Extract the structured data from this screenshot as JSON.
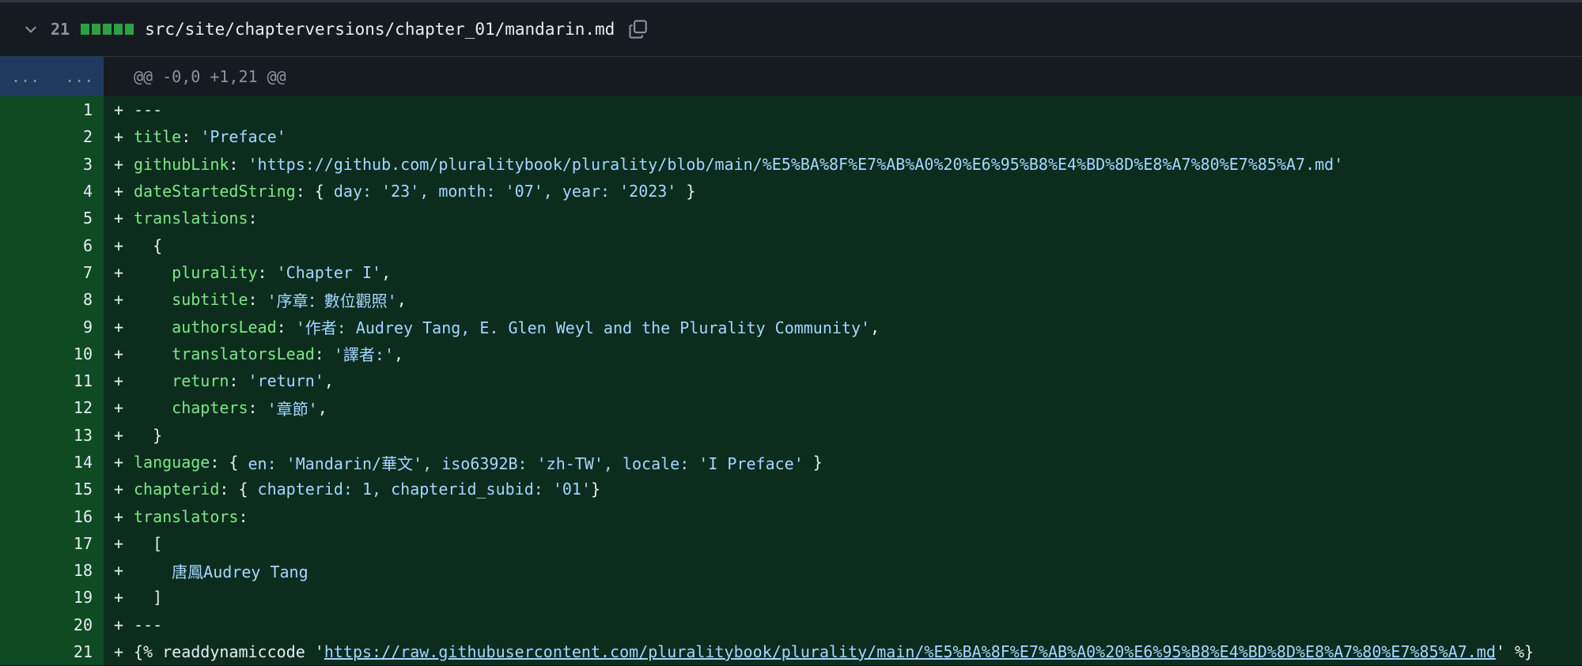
{
  "file": {
    "changes": "21",
    "path": "src/site/chapterversions/chapter_01/mandarin.md",
    "status_color": "#2ea043"
  },
  "hunk": {
    "left_expand": "...",
    "right_expand": "...",
    "header": "@@ -0,0 +1,21 @@"
  },
  "lines": [
    {
      "n": "1",
      "segs": [
        {
          "c": "p",
          "t": "---"
        }
      ]
    },
    {
      "n": "2",
      "segs": [
        {
          "c": "k",
          "t": "title"
        },
        {
          "c": "p",
          "t": ": "
        },
        {
          "c": "s",
          "t": "'Preface'"
        }
      ]
    },
    {
      "n": "3",
      "segs": [
        {
          "c": "k",
          "t": "githubLink"
        },
        {
          "c": "p",
          "t": ": "
        },
        {
          "c": "s",
          "t": "'https://github.com/pluralitybook/plurality/blob/main/%E5%BA%8F%E7%AB%A0%20%E6%95%B8%E4%BD%8D%E8%A7%80%E7%85%A7.md'"
        }
      ]
    },
    {
      "n": "4",
      "segs": [
        {
          "c": "k",
          "t": "dateStartedString"
        },
        {
          "c": "p",
          "t": ": { "
        },
        {
          "c": "s",
          "t": "day: '23', month: '07', year: '2023'"
        },
        {
          "c": "p",
          "t": " }"
        }
      ]
    },
    {
      "n": "5",
      "segs": [
        {
          "c": "k",
          "t": "translations"
        },
        {
          "c": "p",
          "t": ":"
        }
      ]
    },
    {
      "n": "6",
      "segs": [
        {
          "c": "p",
          "t": "  {"
        }
      ]
    },
    {
      "n": "7",
      "segs": [
        {
          "c": "p",
          "t": "    "
        },
        {
          "c": "k",
          "t": "plurality"
        },
        {
          "c": "p",
          "t": ": "
        },
        {
          "c": "s",
          "t": "'Chapter I'"
        },
        {
          "c": "p",
          "t": ","
        }
      ]
    },
    {
      "n": "8",
      "segs": [
        {
          "c": "p",
          "t": "    "
        },
        {
          "c": "k",
          "t": "subtitle"
        },
        {
          "c": "p",
          "t": ": "
        },
        {
          "c": "s",
          "t": "'序章：數位觀照'"
        },
        {
          "c": "p",
          "t": ","
        }
      ]
    },
    {
      "n": "9",
      "segs": [
        {
          "c": "p",
          "t": "    "
        },
        {
          "c": "k",
          "t": "authorsLead"
        },
        {
          "c": "p",
          "t": ": "
        },
        {
          "c": "s",
          "t": "'作者: Audrey Tang, E. Glen Weyl and the Plurality Community'"
        },
        {
          "c": "p",
          "t": ","
        }
      ]
    },
    {
      "n": "10",
      "segs": [
        {
          "c": "p",
          "t": "    "
        },
        {
          "c": "k",
          "t": "translatorsLead"
        },
        {
          "c": "p",
          "t": ": "
        },
        {
          "c": "s",
          "t": "'譯者:'"
        },
        {
          "c": "p",
          "t": ","
        }
      ]
    },
    {
      "n": "11",
      "segs": [
        {
          "c": "p",
          "t": "    "
        },
        {
          "c": "k",
          "t": "return"
        },
        {
          "c": "p",
          "t": ": "
        },
        {
          "c": "s",
          "t": "'return'"
        },
        {
          "c": "p",
          "t": ","
        }
      ]
    },
    {
      "n": "12",
      "segs": [
        {
          "c": "p",
          "t": "    "
        },
        {
          "c": "k",
          "t": "chapters"
        },
        {
          "c": "p",
          "t": ": "
        },
        {
          "c": "s",
          "t": "'章節'"
        },
        {
          "c": "p",
          "t": ","
        }
      ]
    },
    {
      "n": "13",
      "segs": [
        {
          "c": "p",
          "t": "  }"
        }
      ]
    },
    {
      "n": "14",
      "segs": [
        {
          "c": "k",
          "t": "language"
        },
        {
          "c": "p",
          "t": ": { "
        },
        {
          "c": "s",
          "t": "en: 'Mandarin/華文', iso6392B: 'zh-TW', locale: 'I Preface'"
        },
        {
          "c": "p",
          "t": " }"
        }
      ]
    },
    {
      "n": "15",
      "segs": [
        {
          "c": "k",
          "t": "chapterid"
        },
        {
          "c": "p",
          "t": ": { "
        },
        {
          "c": "s",
          "t": "chapterid: 1, chapterid_subid: '01'"
        },
        {
          "c": "p",
          "t": "}"
        }
      ]
    },
    {
      "n": "16",
      "segs": [
        {
          "c": "k",
          "t": "translators"
        },
        {
          "c": "p",
          "t": ":"
        }
      ]
    },
    {
      "n": "17",
      "segs": [
        {
          "c": "p",
          "t": "  ["
        }
      ]
    },
    {
      "n": "18",
      "segs": [
        {
          "c": "p",
          "t": "    "
        },
        {
          "c": "s",
          "t": "唐鳳Audrey Tang"
        }
      ]
    },
    {
      "n": "19",
      "segs": [
        {
          "c": "p",
          "t": "  ]"
        }
      ]
    },
    {
      "n": "20",
      "segs": [
        {
          "c": "p",
          "t": "---"
        }
      ]
    },
    {
      "n": "21",
      "segs": [
        {
          "c": "p",
          "t": "{% readdynamiccode '"
        },
        {
          "c": "u",
          "t": "https://raw.githubusercontent.com/pluralitybook/plurality/main/%E5%BA%8F%E7%AB%A0%20%E6%95%B8%E4%BD%8D%E8%A7%80%E7%85%A7.md"
        },
        {
          "c": "p",
          "t": "' %}"
        }
      ]
    }
  ]
}
